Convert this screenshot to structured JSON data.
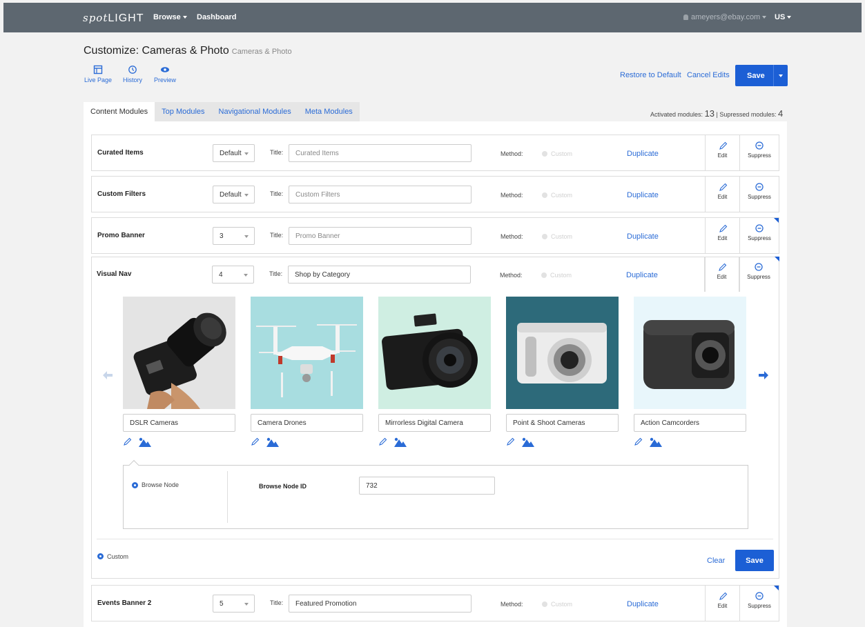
{
  "nav": {
    "brand_script": "spot",
    "brand_caps": "LIGHT",
    "browse": "Browse",
    "dashboard": "Dashboard",
    "user_email": "ameyers@ebay.com",
    "region": "US"
  },
  "header": {
    "title": "Customize: Cameras & Photo",
    "subtitle": "Cameras & Photo",
    "tools": [
      {
        "label": "Live Page",
        "icon": "live-page-icon"
      },
      {
        "label": "History",
        "icon": "history-icon"
      },
      {
        "label": "Preview",
        "icon": "eye-icon"
      }
    ],
    "restore": "Restore to Default",
    "cancel": "Cancel Edits",
    "save": "Save"
  },
  "tabs": [
    "Content Modules",
    "Top Modules",
    "Navigational Modules",
    "Meta Modules"
  ],
  "counts": {
    "activated_label": "Activated modules:",
    "activated": "13",
    "sep": "|",
    "suppressed_label": "Supressed modules:",
    "suppressed": "4"
  },
  "labels": {
    "title": "Title:",
    "method": "Method:",
    "custom": "Custom",
    "duplicate": "Duplicate",
    "edit": "Edit",
    "suppress": "Suppress"
  },
  "modules": [
    {
      "name": "Curated Items",
      "select": "Default",
      "title": "Curated Items"
    },
    {
      "name": "Custom Filters",
      "select": "Default",
      "title": "Custom Filters"
    },
    {
      "name": "Promo Banner",
      "select": "3",
      "title": "Promo Banner"
    },
    {
      "name": "Visual Nav",
      "select": "4",
      "title": "Shop by Category"
    },
    {
      "name": "Events Banner 2",
      "select": "5",
      "title": "Featured Promotion"
    }
  ],
  "visual_nav": {
    "cards": [
      {
        "label": "DSLR Cameras",
        "bg": "#e4e4e4"
      },
      {
        "label": "Camera Drones",
        "bg": "#a8dde0"
      },
      {
        "label": "Mirrorless Digital Camera",
        "bg": "#cfeee2"
      },
      {
        "label": "Point & Shoot Cameras",
        "bg": "#2d6a7a"
      },
      {
        "label": "Action Camcorders",
        "bg": "#e8f6fb"
      }
    ],
    "browse_node": "Browse Node",
    "browse_node_id_label": "Browse Node ID",
    "browse_node_id": "732",
    "custom": "Custom",
    "clear": "Clear",
    "save": "Save"
  },
  "colors": {
    "accent": "#1c5fd5",
    "link": "#2a6bd6",
    "topbar": "#5d6770"
  }
}
